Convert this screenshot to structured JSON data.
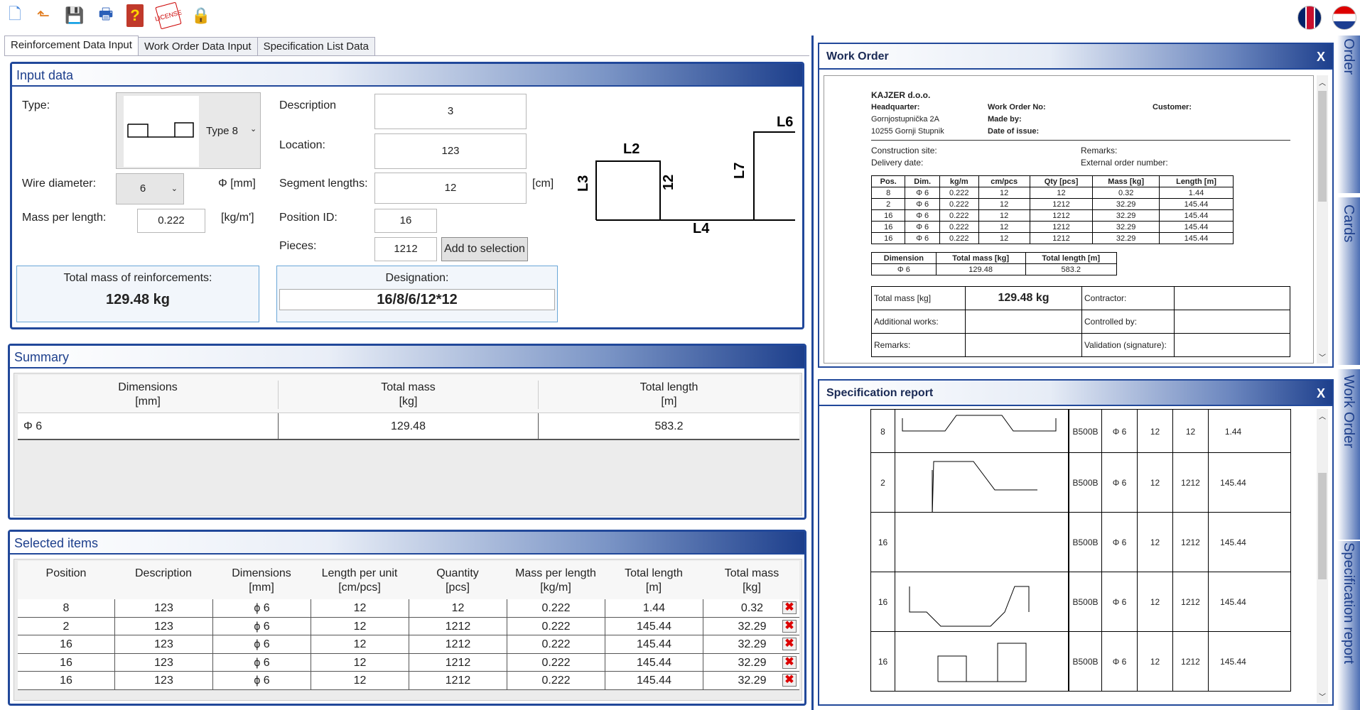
{
  "toolbar": {
    "icons": [
      "new-document-icon",
      "open-folder-icon",
      "save-icon",
      "print-icon",
      "help-book-icon",
      "license-stamp-icon",
      "lock-icon"
    ]
  },
  "tabs": [
    "Reinforcement Data Input",
    "Work Order Data Input",
    "Specification List Data"
  ],
  "input": {
    "title": "Input data",
    "type_label": "Type:",
    "type_value": "Type 8",
    "wire_label": "Wire diameter:",
    "wire_value": "6",
    "wire_unit": "Φ [mm]",
    "mpl_label": "Mass per length:",
    "mpl_value": "0.222",
    "mpl_unit": "[kg/m']",
    "desc_label": "Description",
    "desc_value": "3",
    "loc_label": "Location:",
    "loc_value": "123",
    "seg_label": "Segment lengths:",
    "seg_value": "12",
    "seg_unit": "[cm]",
    "pos_label": "Position ID:",
    "pos_value": "16",
    "pieces_label": "Pieces:",
    "pieces_value": "1212",
    "add_button": "Add to selection",
    "total_label": "Total mass of reinforcements:",
    "total_value": "129.48 kg",
    "designation_label": "Designation:",
    "designation_value": "16/8/6/12*12",
    "shape_labels": {
      "l2": "L2",
      "l3": "L3",
      "l4": "L4",
      "l6": "L6",
      "l7": "L7",
      "seg": "12"
    }
  },
  "summary": {
    "title": "Summary",
    "headers": [
      [
        "Dimensions",
        "[mm]"
      ],
      [
        "Total mass",
        "[kg]"
      ],
      [
        "Total length",
        "[m]"
      ]
    ],
    "row": [
      "Φ  6",
      "129.48",
      "583.2"
    ]
  },
  "selected": {
    "title": "Selected items",
    "headers": [
      [
        "Position",
        ""
      ],
      [
        "Description",
        ""
      ],
      [
        "Dimensions",
        "[mm]"
      ],
      [
        "Length per unit",
        "[cm/pcs]"
      ],
      [
        "Quantity",
        "[pcs]"
      ],
      [
        "Mass per length",
        "[kg/m]"
      ],
      [
        "Total length",
        "[m]"
      ],
      [
        "Total mass",
        "[kg]"
      ]
    ],
    "rows": [
      [
        "8",
        "123",
        "ϕ 6",
        "12",
        "12",
        "0.222",
        "1.44",
        "0.32"
      ],
      [
        "2",
        "123",
        "ϕ 6",
        "12",
        "1212",
        "0.222",
        "145.44",
        "32.29"
      ],
      [
        "16",
        "123",
        "ϕ 6",
        "12",
        "1212",
        "0.222",
        "145.44",
        "32.29"
      ],
      [
        "16",
        "123",
        "ϕ 6",
        "12",
        "1212",
        "0.222",
        "145.44",
        "32.29"
      ],
      [
        "16",
        "123",
        "ϕ 6",
        "12",
        "1212",
        "0.222",
        "145.44",
        "32.29"
      ]
    ]
  },
  "work_order": {
    "title": "Work Order",
    "close": "X",
    "company": "KAJZER d.o.o.",
    "headquarter": "Headquarter:",
    "address1": "Gornjostupnička 2A",
    "address2": "10255 Gornji Stupnik",
    "wo_no": "Work Order No:",
    "made_by": "Made by:",
    "date_issue": "Date of issue:",
    "customer": "Customer:",
    "construction": "Construction site:",
    "delivery": "Delivery date:",
    "remarks_top": "Remarks:",
    "external": "External order number:",
    "table_headers": [
      "Pos.",
      "Dim.",
      "kg/m",
      "cm/pcs",
      "Qty [pcs]",
      "Mass [kg]",
      "Length [m]"
    ],
    "table_rows": [
      [
        "8",
        "Φ 6",
        "0.222",
        "12",
        "12",
        "0.32",
        "1.44"
      ],
      [
        "2",
        "Φ 6",
        "0.222",
        "12",
        "1212",
        "32.29",
        "145.44"
      ],
      [
        "16",
        "Φ 6",
        "0.222",
        "12",
        "1212",
        "32.29",
        "145.44"
      ],
      [
        "16",
        "Φ 6",
        "0.222",
        "12",
        "1212",
        "32.29",
        "145.44"
      ],
      [
        "16",
        "Φ 6",
        "0.222",
        "12",
        "1212",
        "32.29",
        "145.44"
      ]
    ],
    "sum_headers": [
      "Dimension",
      "Total mass [kg]",
      "Total length [m]"
    ],
    "sum_row": [
      "Φ 6",
      "129.48",
      "583.2"
    ],
    "total_mass_label": "Total mass [kg]",
    "total_mass_value": "129.48 kg",
    "contractor": "Contractor:",
    "additional": "Additional works:",
    "controlled": "Controlled by:",
    "remarks": "Remarks:",
    "validation": "Validation (signature):"
  },
  "spec": {
    "title": "Specification report",
    "close": "X",
    "rows": [
      {
        "pos": "8",
        "grade": "B500B",
        "dim": "Φ 6",
        "len": "12",
        "qty": "12",
        "val": "1.44"
      },
      {
        "pos": "2",
        "grade": "B500B",
        "dim": "Φ 6",
        "len": "12",
        "qty": "1212",
        "val": "145.44"
      },
      {
        "pos": "16",
        "grade": "B500B",
        "dim": "Φ 6",
        "len": "12",
        "qty": "1212",
        "val": "145.44"
      },
      {
        "pos": "16",
        "grade": "B500B",
        "dim": "Φ 6",
        "len": "12",
        "qty": "1212",
        "val": "145.44"
      },
      {
        "pos": "16",
        "grade": "B500B",
        "dim": "Φ 6",
        "len": "12",
        "qty": "1212",
        "val": "145.44"
      }
    ]
  },
  "side_tabs": [
    "Order",
    "Cards",
    "Work Order",
    "Specification report"
  ]
}
